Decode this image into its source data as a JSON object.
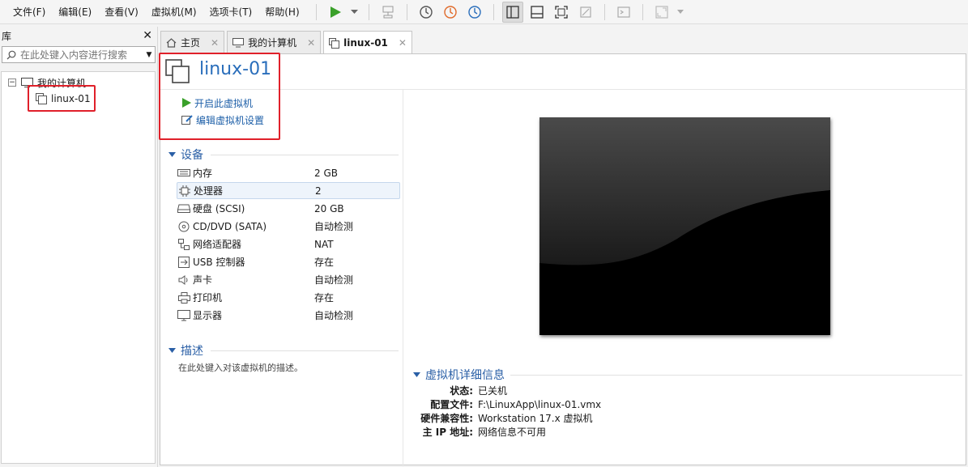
{
  "menu": [
    "文件(F)",
    "编辑(E)",
    "查看(V)",
    "虚拟机(M)",
    "选项卡(T)",
    "帮助(H)"
  ],
  "library": {
    "title": "库",
    "search_placeholder": "在此处键入内容进行搜索",
    "tree_root": "我的计算机",
    "tree_child": "linux-01"
  },
  "tabs": [
    {
      "label": "主页"
    },
    {
      "label": "我的计算机"
    },
    {
      "label": "linux-01"
    }
  ],
  "vm": {
    "title": "linux-01",
    "actions": {
      "power_on": "开启此虚拟机",
      "edit_settings": "编辑虚拟机设置"
    },
    "devices_title": "设备",
    "devices": [
      {
        "name": "内存",
        "value": "2 GB",
        "icon": "memory-icon"
      },
      {
        "name": "处理器",
        "value": "2",
        "icon": "cpu-icon"
      },
      {
        "name": "硬盘 (SCSI)",
        "value": "20 GB",
        "icon": "hdd-icon"
      },
      {
        "name": "CD/DVD (SATA)",
        "value": "自动检测",
        "icon": "cd-icon"
      },
      {
        "name": "网络适配器",
        "value": "NAT",
        "icon": "network-icon"
      },
      {
        "name": "USB 控制器",
        "value": "存在",
        "icon": "usb-icon"
      },
      {
        "name": "声卡",
        "value": "自动检测",
        "icon": "speaker-icon"
      },
      {
        "name": "打印机",
        "value": "存在",
        "icon": "printer-icon"
      },
      {
        "name": "显示器",
        "value": "自动检测",
        "icon": "monitor-icon"
      }
    ],
    "description_title": "描述",
    "description_placeholder": "在此处键入对该虚拟机的描述。",
    "details_title": "虚拟机详细信息",
    "details": [
      {
        "key": "状态:",
        "value": "已关机"
      },
      {
        "key": "配置文件:",
        "value": "F:\\LinuxApp\\linux-01.vmx"
      },
      {
        "key": "硬件兼容性:",
        "value": "Workstation 17.x 虚拟机"
      },
      {
        "key": "主 IP 地址:",
        "value": "网络信息不可用"
      }
    ]
  },
  "colors": {
    "accent": "#2a6ebb",
    "highlight_box": "#e0202a",
    "play_green": "#3aa02a"
  }
}
